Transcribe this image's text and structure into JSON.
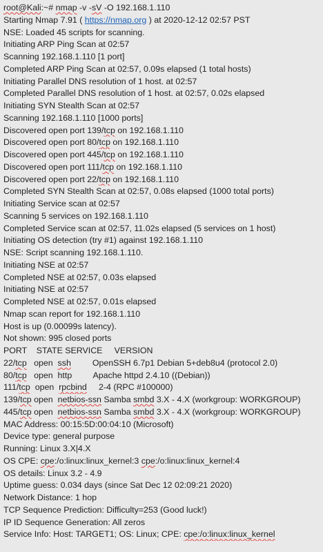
{
  "terminal": {
    "lines": [
      [
        {
          "t": "root@Kali",
          "s": 1
        },
        {
          "t": ":~# "
        },
        {
          "t": "nmap",
          "s": 1
        },
        {
          "t": " -v -"
        },
        {
          "t": "sV",
          "s": 1
        },
        {
          "t": " -O 192.168.1.110"
        }
      ],
      [
        {
          "t": "Starting Nmap 7.91 ( "
        },
        {
          "t": "https://nmap.org",
          "l": 1
        },
        {
          "t": " ) at 2020-12-12 02:57 PST"
        }
      ],
      [
        {
          "t": "NSE: Loaded 45 scripts for scanning."
        }
      ],
      [
        {
          "t": "Initiating ARP Ping Scan at 02:57"
        }
      ],
      [
        {
          "t": "Scanning 192.168.1.110 [1 port]"
        }
      ],
      [
        {
          "t": "Completed ARP Ping Scan at 02:57, 0.09s elapsed (1 total hosts)"
        }
      ],
      [
        {
          "t": "Initiating Parallel DNS resolution of 1 host. at 02:57"
        }
      ],
      [
        {
          "t": "Completed Parallel DNS resolution of 1 host. at 02:57, 0.02s elapsed"
        }
      ],
      [
        {
          "t": "Initiating SYN Stealth Scan at 02:57"
        }
      ],
      [
        {
          "t": "Scanning 192.168.1.110 [1000 ports]"
        }
      ],
      [
        {
          "t": "Discovered open port 139/"
        },
        {
          "t": "tcp",
          "s": 1
        },
        {
          "t": " on 192.168.1.110"
        }
      ],
      [
        {
          "t": "Discovered open port 80/"
        },
        {
          "t": "tcp",
          "s": 1
        },
        {
          "t": " on 192.168.1.110"
        }
      ],
      [
        {
          "t": "Discovered open port 445/"
        },
        {
          "t": "tcp",
          "s": 1
        },
        {
          "t": " on 192.168.1.110"
        }
      ],
      [
        {
          "t": "Discovered open port 111/"
        },
        {
          "t": "tcp",
          "s": 1
        },
        {
          "t": " on 192.168.1.110"
        }
      ],
      [
        {
          "t": "Discovered open port 22/"
        },
        {
          "t": "tcp",
          "s": 1
        },
        {
          "t": " on 192.168.1.110"
        }
      ],
      [
        {
          "t": "Completed SYN Stealth Scan at 02:57, 0.08s elapsed (1000 total ports)"
        }
      ],
      [
        {
          "t": "Initiating Service scan at 02:57"
        }
      ],
      [
        {
          "t": "Scanning 5 services on 192.168.1.110"
        }
      ],
      [
        {
          "t": "Completed Service scan at 02:57, 11.02s elapsed (5 services on 1 host)"
        }
      ],
      [
        {
          "t": "Initiating OS detection (try #1) against 192.168.1.110"
        }
      ],
      [
        {
          "t": "NSE: Script scanning 192.168.1.110."
        }
      ],
      [
        {
          "t": "Initiating NSE at 02:57"
        }
      ],
      [
        {
          "t": "Completed NSE at 02:57, 0.03s elapsed"
        }
      ],
      [
        {
          "t": "Initiating NSE at 02:57"
        }
      ],
      [
        {
          "t": "Completed NSE at 02:57, 0.01s elapsed"
        }
      ],
      [
        {
          "t": "Nmap scan report for 192.168.1.110"
        }
      ],
      [
        {
          "t": "Host is up (0.00099s latency)."
        }
      ],
      [
        {
          "t": "Not shown: 995 closed ports"
        }
      ],
      [
        {
          "t": "PORT    STATE SERVICE     VERSION"
        }
      ],
      [
        {
          "t": "22/"
        },
        {
          "t": "tcp",
          "s": 1
        },
        {
          "t": "   open  "
        },
        {
          "t": "ssh",
          "s": 1
        },
        {
          "t": "         OpenSSH 6.7p1 Debian 5+deb8u4 (protocol 2.0)"
        }
      ],
      [
        {
          "t": "80/"
        },
        {
          "t": "tcp",
          "s": 1
        },
        {
          "t": "   open  http         Apache httpd 2.4.10 ((Debian))"
        }
      ],
      [
        {
          "t": "111/"
        },
        {
          "t": "tcp",
          "s": 1
        },
        {
          "t": "  open  "
        },
        {
          "t": "rpcbind",
          "s": 1
        },
        {
          "t": "     2-4 (RPC #100000)"
        }
      ],
      [
        {
          "t": "139/"
        },
        {
          "t": "tcp",
          "s": 1
        },
        {
          "t": " open  "
        },
        {
          "t": "netbios-ssn",
          "s": 1
        },
        {
          "t": " Samba "
        },
        {
          "t": "smbd",
          "s": 1
        },
        {
          "t": " 3.X - 4.X (workgroup: WORKGROUP)"
        }
      ],
      [
        {
          "t": "445/"
        },
        {
          "t": "tcp",
          "s": 1
        },
        {
          "t": " open  "
        },
        {
          "t": "netbios-ssn",
          "s": 1
        },
        {
          "t": " Samba "
        },
        {
          "t": "smbd",
          "s": 1
        },
        {
          "t": " 3.X - 4.X (workgroup: WORKGROUP)"
        }
      ],
      [
        {
          "t": "MAC Address: 00:15:5D:00:04:10 (Microsoft)"
        }
      ],
      [
        {
          "t": "Device type: general purpose"
        }
      ],
      [
        {
          "t": "Running: Linux 3.X|4.X"
        }
      ],
      [
        {
          "t": "OS CPE: "
        },
        {
          "t": "cpe",
          "s": 1
        },
        {
          "t": ":/o:linux:linux_kernel:3 "
        },
        {
          "t": "cpe",
          "s": 1
        },
        {
          "t": ":/o:linux:linux_kernel:4"
        }
      ],
      [
        {
          "t": "OS details: Linux 3.2 - 4.9"
        }
      ],
      [
        {
          "t": "Uptime guess: 0.034 days (since Sat Dec 12 02:09:21 2020)"
        }
      ],
      [
        {
          "t": "Network Distance: 1 hop"
        }
      ],
      [
        {
          "t": "TCP Sequence Prediction: Difficulty=253 (Good luck!)"
        }
      ],
      [
        {
          "t": "IP ID Sequence Generation: All zeros"
        }
      ],
      [
        {
          "t": "Service Info: Host: TARGET1; OS: Linux; CPE: "
        },
        {
          "t": "cpe:/o:linux:linux_kernel",
          "s": 1
        }
      ]
    ]
  }
}
